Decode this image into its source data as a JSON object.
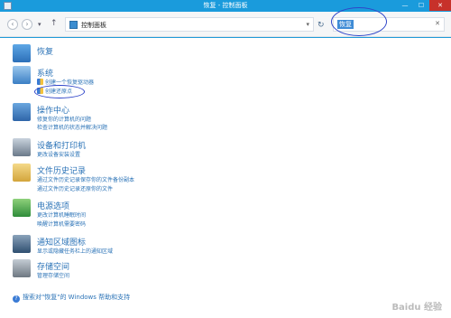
{
  "window": {
    "title": "恢复 - 控制面板",
    "controls": {
      "minimize": "—",
      "maximize": "☐",
      "close": "✕"
    }
  },
  "address_bar": {
    "back_icon": "back-arrow-icon",
    "forward_icon": "forward-arrow-icon",
    "up_icon": "up-arrow-icon",
    "path": "控制面板",
    "search_value": "恢复",
    "search_clear": "✕"
  },
  "sections": [
    {
      "title": "恢复",
      "icon": "recovery-icon",
      "links": []
    },
    {
      "title": "系统",
      "icon": "system-icon",
      "links": [
        "创建一个恢复驱动器",
        "创建还原点"
      ]
    },
    {
      "title": "操作中心",
      "icon": "flag-icon",
      "links": [
        "修复你的计算机的问题",
        "检查计算机的状态并解决问题"
      ]
    },
    {
      "title": "设备和打印机",
      "icon": "printer-icon",
      "links": [
        "更改设备安装设置"
      ]
    },
    {
      "title": "文件历史记录",
      "icon": "file-history-icon",
      "links": [
        "通过文件历史记录保存你的文件备份副本",
        "通过文件历史记录还原你的文件"
      ]
    },
    {
      "title": "电源选项",
      "icon": "battery-icon",
      "links": [
        "更改计算机睡眠时间",
        "唤醒计算机需要密码"
      ]
    },
    {
      "title": "通知区域图标",
      "icon": "taskbar-icon",
      "links": [
        "显示或隐藏任务栏上的通知区域"
      ]
    },
    {
      "title": "存储空间",
      "icon": "storage-icon",
      "links": [
        "管理存储空间"
      ]
    }
  ],
  "help_link": "搜索对\"恢复\"的 Windows 帮助和支持",
  "watermark": "Baidu 经验",
  "colors": {
    "accent": "#1a9bdc",
    "link": "#2b73b7",
    "close": "#c7312a",
    "annotation": "#2f45c9"
  }
}
